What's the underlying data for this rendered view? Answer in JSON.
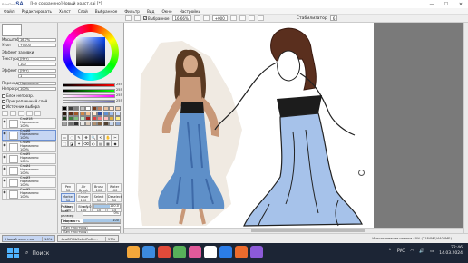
{
  "app": {
    "logo_small": "PaintTool",
    "logo": "SAI",
    "title": "[Не сохранено]Новый холст.sai [*]"
  },
  "menu": [
    "Файл",
    "Редактировать",
    "Холст",
    "Слой",
    "Выбранное",
    "Фильтр",
    "Вид",
    "Окно",
    "Настройки"
  ],
  "toolbar": {
    "zoom": "16.66%",
    "angle": "+000",
    "selected_label": "Выбранное",
    "stabilizer_label": "Стабилизатор",
    "stabilizer_value": "6"
  },
  "left": {
    "zoom_label": "Масштаб",
    "zoom_value": "16.7%",
    "angle_label": "Угол",
    "angle_value": "+0000",
    "effect_label": "Эффект заливки",
    "texture_label": "Текстура",
    "texture_value": "(Нет)",
    "texture2_value": "100",
    "effect2_label": "Эффект",
    "effect2_value": "(Нет)",
    "effect3_value": "1",
    "mode_label": "Переход",
    "mode_value": "Нормально",
    "opacity_label": "Непрозр.ть",
    "opacity_value": "100%",
    "checks": [
      "Блок непрозр.",
      "Прикрепленный слой",
      "Источник выбора"
    ],
    "layers": [
      {
        "name": "Слой18",
        "mode": "Нормально",
        "opacity": "100%"
      },
      {
        "name": "Слой8",
        "mode": "Нормально",
        "opacity": "100%"
      },
      {
        "name": "Слой6",
        "mode": "Нормально",
        "opacity": "100%"
      },
      {
        "name": "Слой5",
        "mode": "Нормально",
        "opacity": "100%"
      },
      {
        "name": "Слой4",
        "mode": "Нормально",
        "opacity": "100%"
      },
      {
        "name": "Слой3",
        "mode": "Нормально",
        "opacity": "100%"
      },
      {
        "name": "Слой2",
        "mode": "Нормально",
        "opacity": "100%"
      }
    ]
  },
  "color": {
    "slider_values": [
      "255",
      "255",
      "255",
      "255"
    ],
    "swatches": [
      "#000000",
      "#404040",
      "#808080",
      "#c0c0c0",
      "#ffffff",
      "#7a3a1a",
      "#c08060",
      "#e8c0a0",
      "#ffe0c8",
      "#f0d0b0",
      "#2a1a10",
      "#603018",
      "#a05828",
      "#d08848",
      "#f4c090",
      "#ffe8d0",
      "#3050a0",
      "#6090d0",
      "#a0c0f0",
      "#d0e0ff",
      "#204020",
      "#408040",
      "#80c080",
      "#c0e8c0",
      "#a02020",
      "#e04040",
      "#f08080",
      "#ffc0c0",
      "#e0b040",
      "#fff080",
      "#a0a0a0",
      "#707070",
      "#303030",
      "#e8e8e8",
      "#d8c8b8",
      "#b09070",
      "#806040",
      "#504030",
      "#c8d8f0",
      "#90a8d0"
    ],
    "tool_icons": [
      "▭",
      "◌",
      "✎",
      "✥",
      "🔍",
      "⟲",
      "✋",
      "✂",
      "⬚",
      "◪",
      "✦",
      "⌫",
      "◐",
      "▤",
      "▦",
      "◆"
    ],
    "brushes": [
      {
        "label": "Pen",
        "size": "50"
      },
      {
        "label": "Air Brush",
        "size": "100"
      },
      {
        "label": "Brush",
        "size": "100"
      },
      {
        "label": "Water",
        "size": "100"
      },
      {
        "label": "Marker",
        "size": "50"
      },
      {
        "label": "Eraser",
        "size": "100"
      },
      {
        "label": "Select",
        "size": "50"
      },
      {
        "label": "Deselect",
        "size": "50"
      },
      {
        "label": "Blur",
        "size": "200"
      },
      {
        "label": "Binary",
        "size": "100"
      },
      {
        "label": "Pencil",
        "size": "10"
      },
      {
        "label": "Ink",
        "size": "15"
      }
    ],
    "mode": "Норма",
    "size_label": "Размер",
    "size_mult": "x 5.0",
    "size_value": "120.0",
    "min_label": "Мин. размер",
    "min_value": "0%",
    "density_label": "Плотность",
    "density_value": "100",
    "shape_label": "(Без текстуры)",
    "shape2_label": "(Без текстуры)",
    "shape_value": "50"
  },
  "status": {
    "tab1_name": "Новый холст.sai",
    "tab1_zoom": "16%",
    "tab2_name": "4ca87f4b5e8d7a6c...",
    "tab2_zoom": "97%",
    "memory": "Использование памяти 40% (2184МБ/4400МБ)"
  },
  "taskbar": {
    "search": "Поиск",
    "lang": "РУС",
    "time": "22:46",
    "date": "14.03.2024",
    "app_colors": [
      "#f3a73b",
      "#3c8be0",
      "#e04a3a",
      "#58b05a",
      "#e05a9a",
      "#ffffff",
      "#2b7de9",
      "#ec6b2d",
      "#8c5ad8"
    ]
  }
}
